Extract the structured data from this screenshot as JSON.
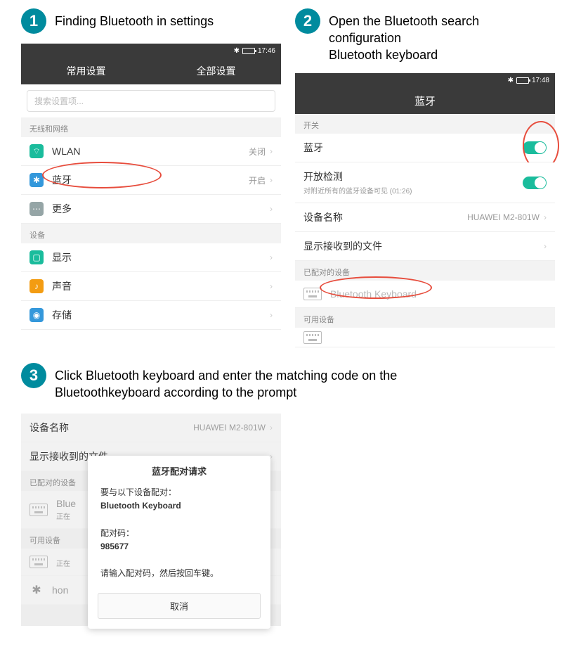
{
  "steps": {
    "s1": {
      "num": "1",
      "text": "Finding Bluetooth in settings"
    },
    "s2": {
      "num": "2",
      "text1": "Open the Bluetooth search configuration",
      "text2": "Bluetooth keyboard"
    },
    "s3": {
      "num": "3",
      "text1": "Click Bluetooth keyboard and enter the matching code on the",
      "text2": "Bluetoothkeyboard according to the prompt"
    }
  },
  "screen1": {
    "time": "17:46",
    "tab1": "常用设置",
    "tab2": "全部设置",
    "search_ph": "搜索设置项...",
    "sec1": "无线和网络",
    "wlan": "WLAN",
    "wlan_val": "关闭",
    "bt": "蓝牙",
    "bt_val": "开启",
    "more": "更多",
    "sec2": "设备",
    "display": "显示",
    "sound": "声音",
    "storage": "存储"
  },
  "screen2": {
    "time": "17:48",
    "title": "蓝牙",
    "sec_switch": "开关",
    "bt_label": "蓝牙",
    "detect": "开放检测",
    "detect_sub": "对附近所有的蓝牙设备可见 (01:26)",
    "dev_name_label": "设备名称",
    "dev_name_value": "HUAWEI M2-801W",
    "recv_files": "显示接收到的文件",
    "paired_hdr": "已配对的设备",
    "kbd": "Bluetooth Keyboard",
    "avail_hdr": "可用设备"
  },
  "screen3": {
    "dev_name_label": "设备名称",
    "dev_name_value": "HUAWEI M2-801W",
    "recv_files": "显示接收到的文件",
    "paired_hdr": "已配对的设备",
    "blu_item": "Blue",
    "blu_sub": "正在",
    "avail_hdr": "可用设备",
    "hon_item": "hon",
    "dialog": {
      "title": "蓝牙配对请求",
      "line1": "要与以下设备配对：",
      "device": "Bluetooth Keyboard",
      "code_label": "配对码：",
      "code": "985677",
      "hint": "请输入配对码，然后按回车键。",
      "cancel": "取消"
    }
  }
}
